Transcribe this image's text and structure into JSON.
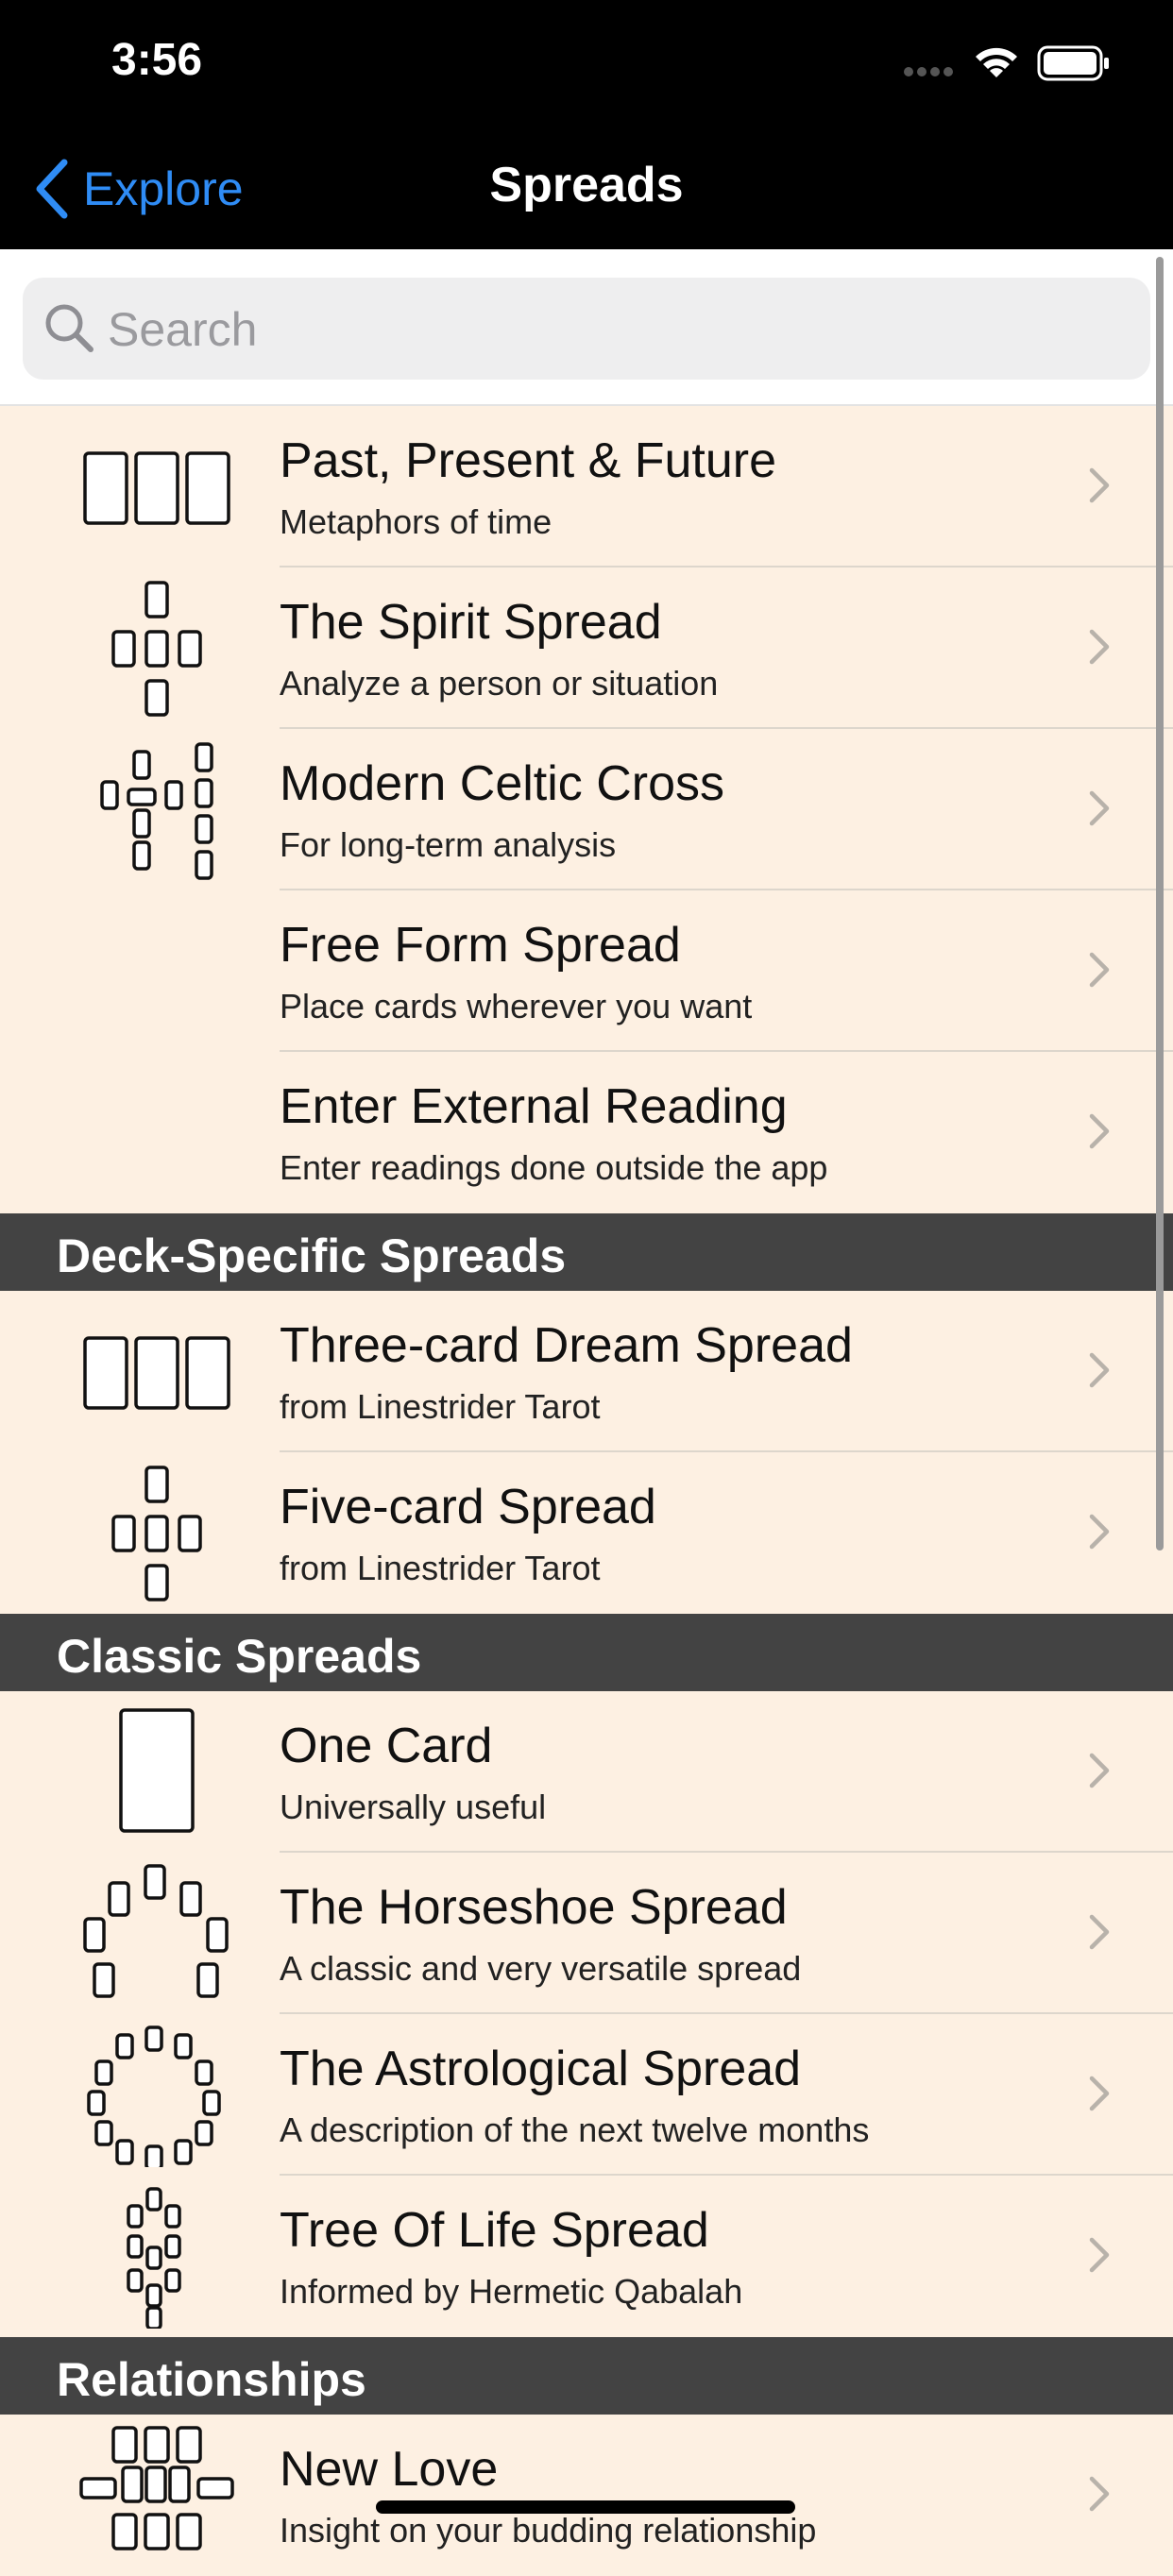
{
  "status": {
    "time": "3:56"
  },
  "nav": {
    "back_label": "Explore",
    "title": "Spreads"
  },
  "search": {
    "placeholder": "Search"
  },
  "colors": {
    "accent": "#2F8CF5",
    "row_bg": "#FDF0E2",
    "header_bg": "#434343"
  },
  "groups": [
    {
      "header": "",
      "items": [
        {
          "title": "Past, Present & Future",
          "subtitle": "Metaphors of time",
          "icon": "three-card-icon"
        },
        {
          "title": "The Spirit Spread",
          "subtitle": "Analyze a person or situation",
          "icon": "cross-five-icon"
        },
        {
          "title": "Modern Celtic Cross",
          "subtitle": "For long-term analysis",
          "icon": "celtic-cross-icon"
        },
        {
          "title": "Free Form Spread",
          "subtitle": "Place cards wherever you want",
          "icon": ""
        },
        {
          "title": "Enter External Reading",
          "subtitle": "Enter readings done outside the app",
          "icon": ""
        }
      ]
    },
    {
      "header": "Deck-Specific Spreads",
      "items": [
        {
          "title": "Three-card Dream Spread",
          "subtitle": "from Linestrider Tarot",
          "icon": "three-card-icon"
        },
        {
          "title": "Five-card Spread",
          "subtitle": "from Linestrider Tarot",
          "icon": "cross-five-icon"
        }
      ]
    },
    {
      "header": "Classic Spreads",
      "items": [
        {
          "title": "One Card",
          "subtitle": "Universally useful",
          "icon": "one-card-icon"
        },
        {
          "title": "The Horseshoe Spread",
          "subtitle": "A classic and very versatile spread",
          "icon": "horseshoe-icon"
        },
        {
          "title": "The Astrological Spread",
          "subtitle": "A description of the next twelve months",
          "icon": "astrological-icon"
        },
        {
          "title": "Tree Of Life Spread",
          "subtitle": "Informed by Hermetic Qabalah",
          "icon": "tree-of-life-icon"
        }
      ]
    },
    {
      "header": "Relationships",
      "items": [
        {
          "title": "New Love",
          "subtitle": "Insight on your budding relationship",
          "icon": "new-love-icon"
        }
      ]
    }
  ]
}
